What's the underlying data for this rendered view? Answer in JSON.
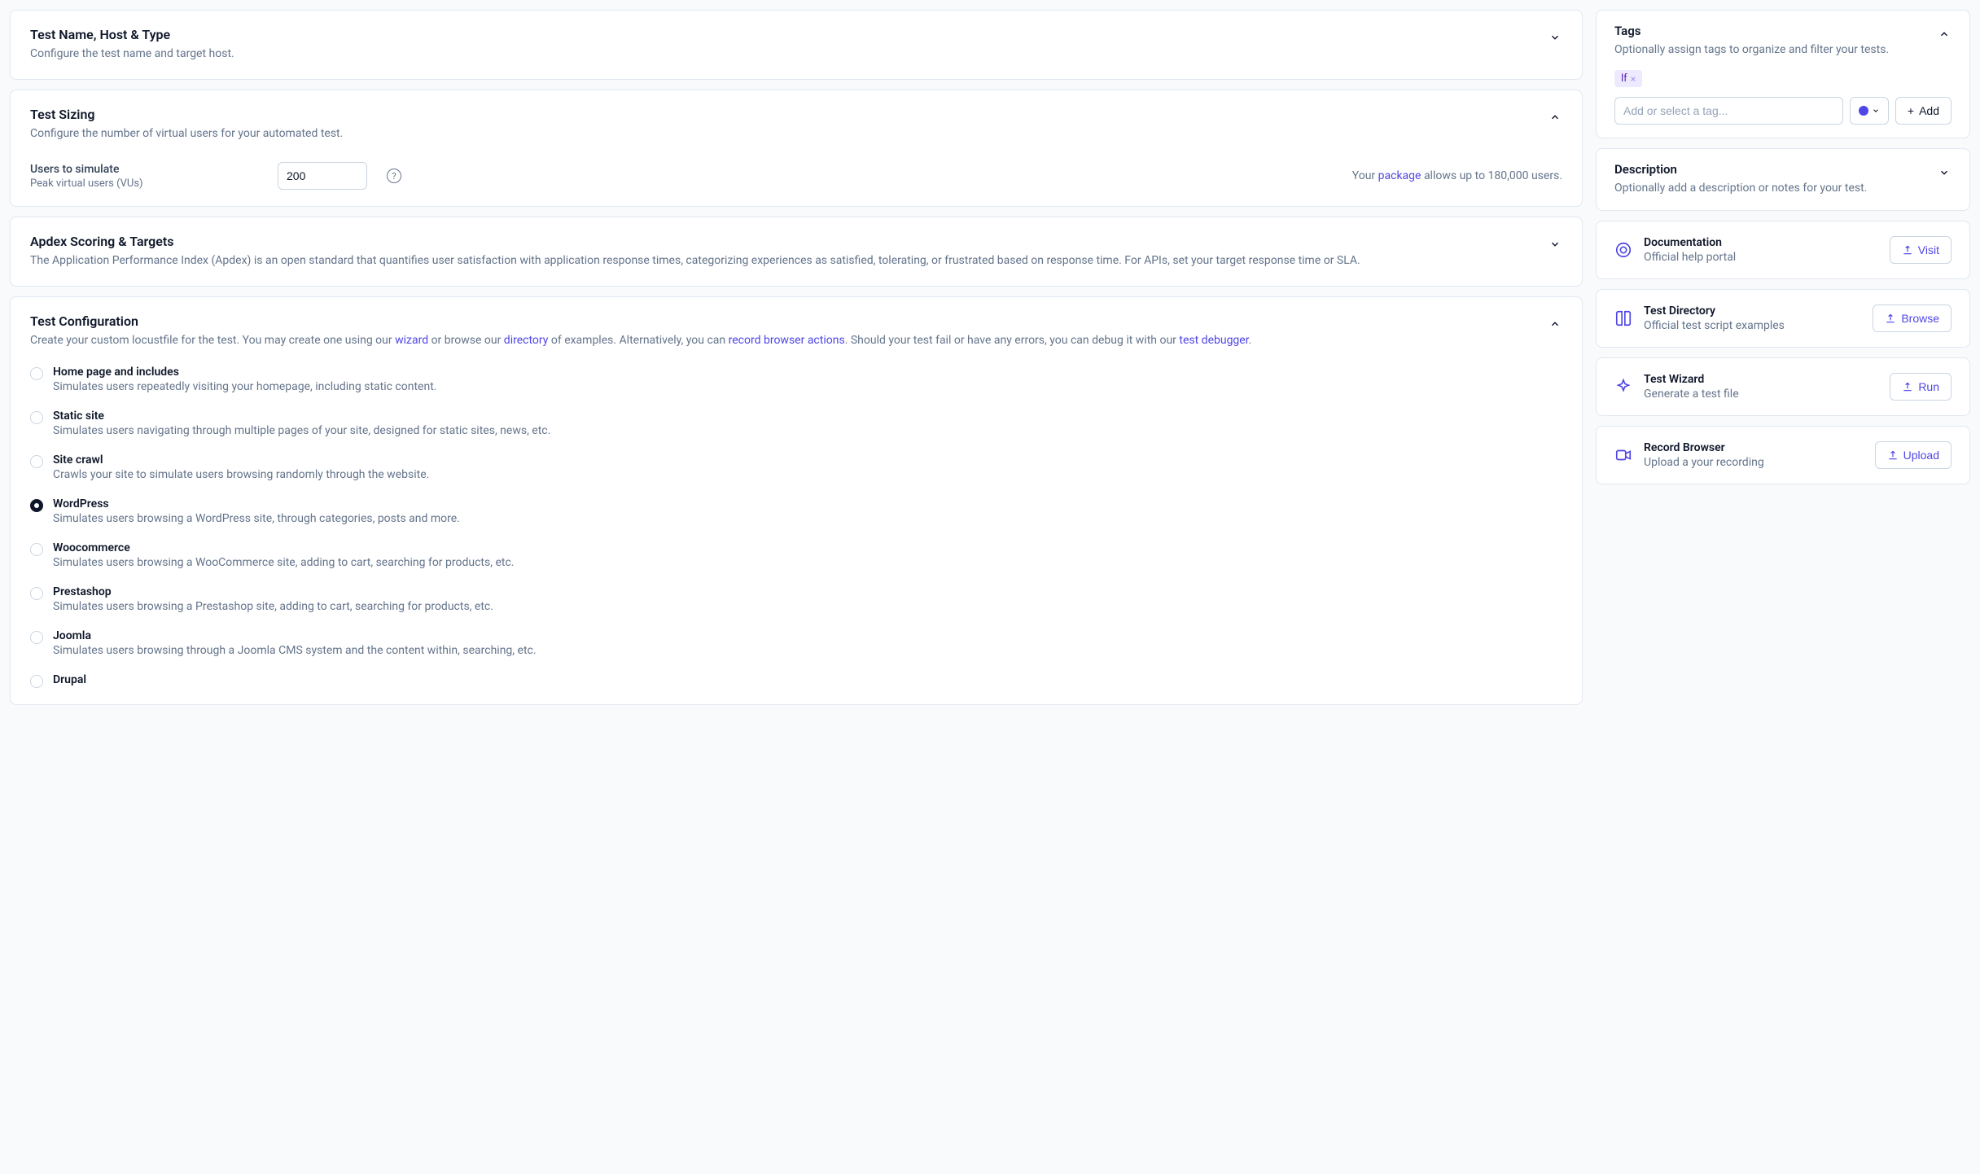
{
  "sections": {
    "nameHost": {
      "title": "Test Name, Host & Type",
      "sub": "Configure the test name and target host."
    },
    "sizing": {
      "title": "Test Sizing",
      "sub": "Configure the number of virtual users for your automated test.",
      "users_label": "Users to simulate",
      "users_hint": "Peak virtual users (VUs)",
      "users_value": "200",
      "allow_pre": "Your ",
      "allow_link": "package",
      "allow_post": " allows up to 180,000 users."
    },
    "apdex": {
      "title": "Apdex Scoring & Targets",
      "sub": "The Application Performance Index (Apdex) is an open standard that quantifies user satisfaction with application response times, categorizing experiences as satisfied, tolerating, or frustrated based on response time. For APIs, set your target response time or SLA."
    },
    "config": {
      "title": "Test Configuration",
      "sub_parts": {
        "p1": "Create your custom locustfile for the test. You may create one using our ",
        "wizard": "wizard",
        "p2": " or browse our ",
        "directory": "directory",
        "p3": " of examples. Alternatively, you can ",
        "record": "record browser actions",
        "p4": ". Should your test fail or have any errors, you can debug it with our ",
        "debugger": "test debugger",
        "p5": "."
      },
      "options": [
        {
          "title": "Home page and includes",
          "desc": "Simulates users repeatedly visiting your homepage, including static content.",
          "selected": false
        },
        {
          "title": "Static site",
          "desc": "Simulates users navigating through multiple pages of your site, designed for static sites, news, etc.",
          "selected": false
        },
        {
          "title": "Site crawl",
          "desc": "Crawls your site to simulate users browsing randomly through the website.",
          "selected": false
        },
        {
          "title": "WordPress",
          "desc": "Simulates users browsing a WordPress site, through categories, posts and more.",
          "selected": true
        },
        {
          "title": "Woocommerce",
          "desc": "Simulates users browsing a WooCommerce site, adding to cart, searching for products, etc.",
          "selected": false
        },
        {
          "title": "Prestashop",
          "desc": "Simulates users browsing a Prestashop site, adding to cart, searching for products, etc.",
          "selected": false
        },
        {
          "title": "Joomla",
          "desc": "Simulates users browsing through a Joomla CMS system and the content within, searching, etc.",
          "selected": false
        },
        {
          "title": "Drupal",
          "desc": "",
          "selected": false
        }
      ]
    }
  },
  "side": {
    "tags": {
      "title": "Tags",
      "sub": "Optionally assign tags to organize and filter your tests.",
      "chips": [
        "lf"
      ],
      "placeholder": "Add or select a tag...",
      "add_label": "Add"
    },
    "description": {
      "title": "Description",
      "sub": "Optionally add a description or notes for your test."
    },
    "resources": [
      {
        "icon": "help",
        "title": "Documentation",
        "sub": "Official help portal",
        "action": "Visit"
      },
      {
        "icon": "book",
        "title": "Test Directory",
        "sub": "Official test script examples",
        "action": "Browse"
      },
      {
        "icon": "sparkle",
        "title": "Test Wizard",
        "sub": "Generate a test file",
        "action": "Run"
      },
      {
        "icon": "video",
        "title": "Record Browser",
        "sub": "Upload a your recording",
        "action": "Upload"
      }
    ]
  },
  "icons": {
    "plus": "+"
  }
}
